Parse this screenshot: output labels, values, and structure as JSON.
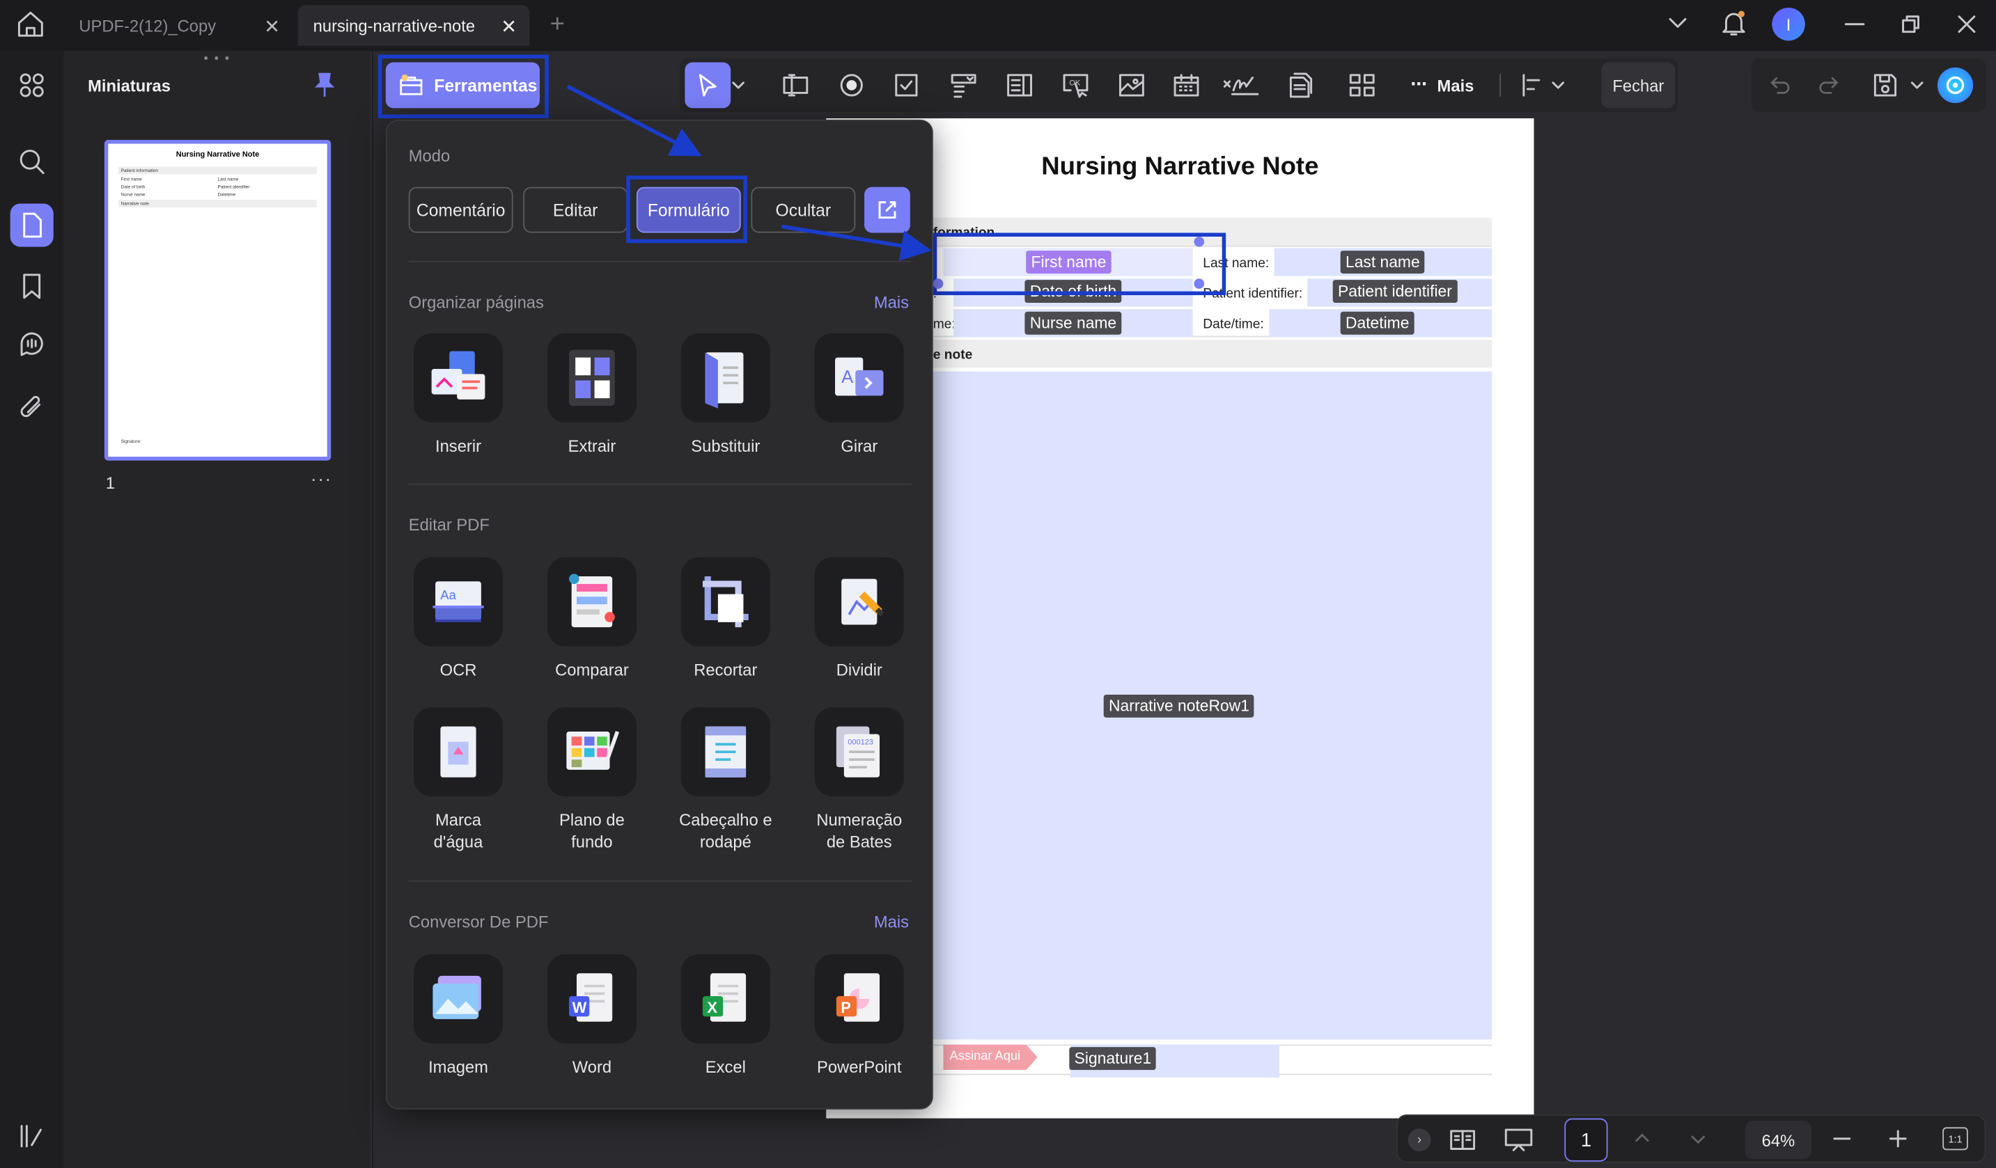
{
  "tabs": [
    {
      "label": "UPDF-2(12)_Copy",
      "active": false
    },
    {
      "label": "nursing-narrative-note",
      "active": true
    }
  ],
  "window": {
    "avatar_initial": "I"
  },
  "thumbnails": {
    "title": "Miniaturas",
    "page_number": "1",
    "thumb_title": "Nursing Narrative Note",
    "thumb_rows": [
      "Patient information",
      "First name",
      "Last name",
      "Date of birth",
      "Patient identifier",
      "Nurse name",
      "Datetime",
      "Narrative note"
    ],
    "thumb_signature": "Signature:"
  },
  "toolbar": {
    "tools_label": "Ferramentas",
    "more_label": "Mais",
    "close_label": "Fechar"
  },
  "tools_menu": {
    "mode_title": "Modo",
    "modes": [
      "Comentário",
      "Editar",
      "Formulário",
      "Ocultar"
    ],
    "organize_title": "Organizar páginas",
    "organize_more": "Mais",
    "organize_items": [
      "Inserir",
      "Extrair",
      "Substituir",
      "Girar"
    ],
    "edit_title": "Editar PDF",
    "edit_items": [
      "OCR",
      "Comparar",
      "Recortar",
      "Dividir"
    ],
    "edit_items2": [
      [
        "Marca",
        "d'água"
      ],
      [
        "Plano de",
        "fundo"
      ],
      [
        "Cabeçalho e",
        "rodapé"
      ],
      [
        "Numeração",
        "de Bates"
      ]
    ],
    "convert_title": "Conversor De PDF",
    "convert_more": "Mais",
    "convert_items": [
      "Imagem",
      "Word",
      "Excel",
      "PowerPoint"
    ]
  },
  "document": {
    "title": "Nursing Narrative Note",
    "section1": "formation",
    "label_first": ":",
    "label_last": "Last name:",
    "label_dob": ":",
    "label_pid": "Patient identifier:",
    "label_nurse": "me:",
    "label_datetime": "Date/time:",
    "section2": "e note",
    "fields": {
      "first_name": "First name",
      "last_name": "Last name",
      "dob": "Date of birth",
      "patient_id": "Patient identifier",
      "nurse_name": "Nurse name",
      "datetime": "Datetime",
      "narrative": "Narrative noteRow1",
      "signature": "Signature1",
      "sign_here": "Assinar Aqui"
    }
  },
  "bottom": {
    "page": "1",
    "zoom": "64%",
    "fit": "1:1"
  },
  "colors": {
    "accent": "#7a7ef5",
    "highlight_box": "#1a3ccc"
  }
}
